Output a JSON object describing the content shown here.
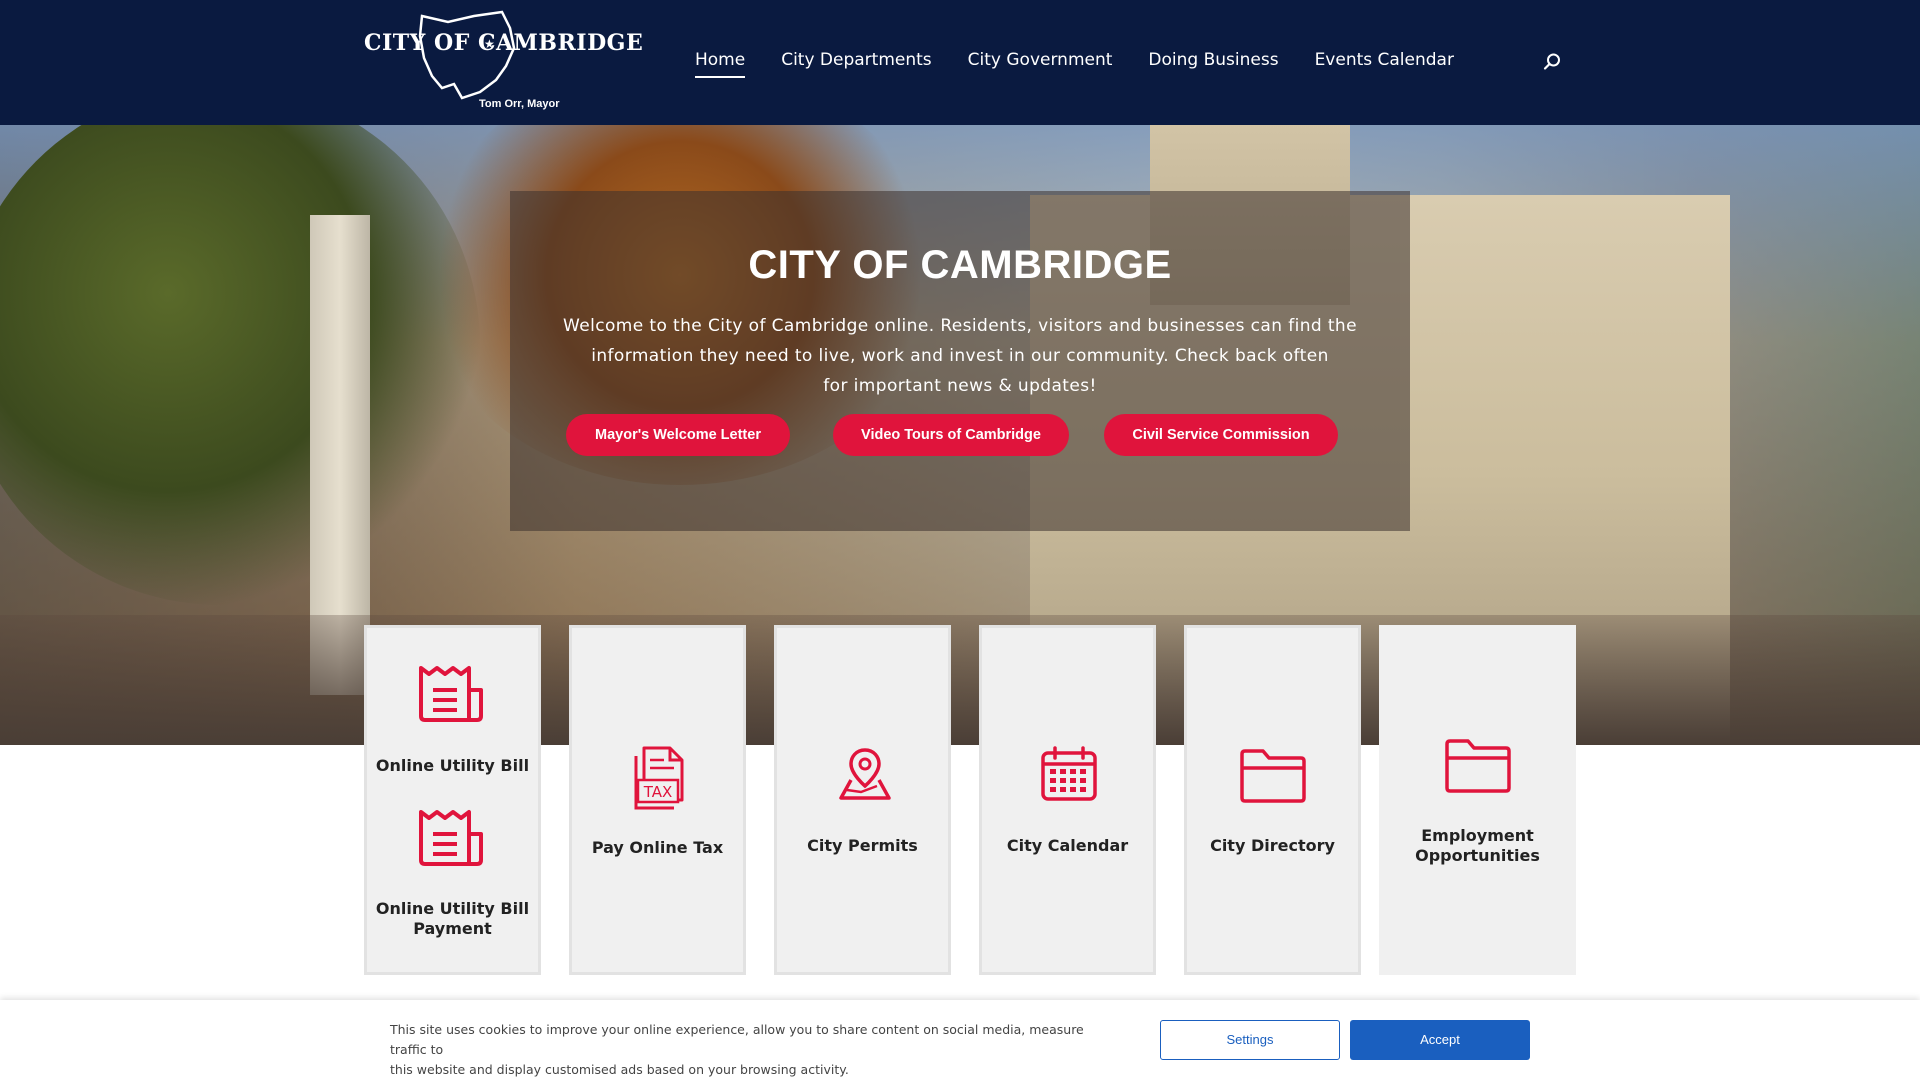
{
  "header": {
    "logo": {
      "line": "CITY OF CAMBRIDGE",
      "mayor": "Tom Orr, Mayor"
    },
    "nav": [
      {
        "label": "Home",
        "active": true
      },
      {
        "label": "City Departments"
      },
      {
        "label": "City Government"
      },
      {
        "label": "Doing Business"
      },
      {
        "label": "Events Calendar"
      }
    ],
    "search_icon": "search-icon"
  },
  "hero": {
    "title": "CITY OF CAMBRIDGE",
    "text_line1": "Welcome to the City of Cambridge online. Residents, visitors and businesses can find the",
    "text_line2": "information they need to live, work and invest in our community. Check back often",
    "text_line3": "for important news & updates!",
    "buttons": [
      "Mayor's Welcome Letter",
      "Video Tours of Cambridge",
      "Civil Service Commission"
    ],
    "accent_color": "#e0143c"
  },
  "cards": [
    {
      "label": "Online Utility Bill",
      "icon": "bill-icon"
    },
    {
      "label_line1": "Online Utility Bill",
      "label_line2": "Payment",
      "icon": "bill-icon"
    },
    {
      "label": "Pay Online Tax",
      "icon": "tax-document-icon",
      "icon_text": "TAX"
    },
    {
      "label": "City Permits",
      "icon": "map-pin-icon"
    },
    {
      "label": "City Calendar",
      "icon": "calendar-icon"
    },
    {
      "label": "City Directory",
      "icon": "folder-icon"
    },
    {
      "label_line1": "Employment",
      "label_line2": "Opportunities",
      "icon": "folder-icon"
    }
  ],
  "cookie_bar": {
    "text_line1": "This site uses cookies to improve your online experience, allow you to share content on social media, measure traffic to",
    "text_line2": "this website and display customised ads based on your browsing activity.",
    "settings_label": "Settings",
    "accept_label": "Accept",
    "button_color": "#1a5fbf"
  }
}
